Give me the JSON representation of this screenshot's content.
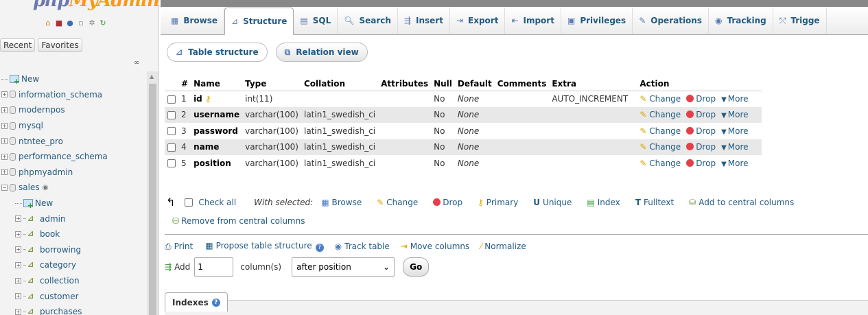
{
  "nav": {
    "logo_a": "php",
    "logo_b": "MyAdmin",
    "tabs": [
      "Recent",
      "Favorites"
    ],
    "tree": [
      {
        "label": "New",
        "type": "new",
        "level": 0
      },
      {
        "label": "information_schema",
        "type": "db",
        "level": 0
      },
      {
        "label": "modernpos",
        "type": "db",
        "level": 0
      },
      {
        "label": "mysql",
        "type": "db",
        "level": 0
      },
      {
        "label": "ntntee_pro",
        "type": "db",
        "level": 0
      },
      {
        "label": "performance_schema",
        "type": "db",
        "level": 0
      },
      {
        "label": "phpmyadmin",
        "type": "db",
        "level": 0
      },
      {
        "label": "sales",
        "type": "db-open",
        "level": 0
      },
      {
        "label": "New",
        "type": "new",
        "level": 1
      },
      {
        "label": "admin",
        "type": "table",
        "level": 1
      },
      {
        "label": "book",
        "type": "table",
        "level": 1
      },
      {
        "label": "borrowing",
        "type": "table",
        "level": 1
      },
      {
        "label": "category",
        "type": "table",
        "level": 1
      },
      {
        "label": "collection",
        "type": "table",
        "level": 1
      },
      {
        "label": "customer",
        "type": "table",
        "level": 1
      },
      {
        "label": "purchases",
        "type": "table",
        "level": 1
      }
    ]
  },
  "tabs": [
    {
      "label": "Browse",
      "icon": "▦",
      "name": "tab-browse"
    },
    {
      "label": "Structure",
      "icon": "⊿",
      "name": "tab-structure",
      "active": true
    },
    {
      "label": "SQL",
      "icon": "▤",
      "name": "tab-sql"
    },
    {
      "label": "Search",
      "icon": "🔍︎",
      "name": "tab-search"
    },
    {
      "label": "Insert",
      "icon": "⇶",
      "name": "tab-insert"
    },
    {
      "label": "Export",
      "icon": "⇥",
      "name": "tab-export"
    },
    {
      "label": "Import",
      "icon": "⇤",
      "name": "tab-import"
    },
    {
      "label": "Privileges",
      "icon": "▣",
      "name": "tab-privileges"
    },
    {
      "label": "Operations",
      "icon": "✎",
      "name": "tab-operations"
    },
    {
      "label": "Tracking",
      "icon": "◉",
      "name": "tab-tracking"
    },
    {
      "label": "Trigge",
      "icon": "⤲",
      "name": "tab-triggers"
    }
  ],
  "subtabs": {
    "structure": "Table structure",
    "relation": "Relation view"
  },
  "table": {
    "headers": [
      "#",
      "Name",
      "Type",
      "Collation",
      "Attributes",
      "Null",
      "Default",
      "Comments",
      "Extra",
      "Action"
    ],
    "rows": [
      {
        "num": "1",
        "name": "id",
        "type": "int(11)",
        "collation": "",
        "attributes": "",
        "null": "No",
        "default": "None",
        "comments": "",
        "extra": "AUTO_INCREMENT",
        "key": true
      },
      {
        "num": "2",
        "name": "username",
        "type": "varchar(100)",
        "collation": "latin1_swedish_ci",
        "attributes": "",
        "null": "No",
        "default": "None",
        "comments": "",
        "extra": ""
      },
      {
        "num": "3",
        "name": "password",
        "type": "varchar(100)",
        "collation": "latin1_swedish_ci",
        "attributes": "",
        "null": "No",
        "default": "None",
        "comments": "",
        "extra": ""
      },
      {
        "num": "4",
        "name": "name",
        "type": "varchar(100)",
        "collation": "latin1_swedish_ci",
        "attributes": "",
        "null": "No",
        "default": "None",
        "comments": "",
        "extra": ""
      },
      {
        "num": "5",
        "name": "position",
        "type": "varchar(100)",
        "collation": "latin1_swedish_ci",
        "attributes": "",
        "null": "No",
        "default": "None",
        "comments": "",
        "extra": ""
      }
    ],
    "actions": {
      "change": "Change",
      "drop": "Drop",
      "more": "More"
    }
  },
  "bulk": {
    "check_all": "Check all",
    "with_selected": "With selected:",
    "browse": "Browse",
    "change": "Change",
    "drop": "Drop",
    "primary": "Primary",
    "unique": "Unique",
    "index": "Index",
    "fulltext": "Fulltext",
    "add_central": "Add to central columns",
    "remove_central": "Remove from central columns"
  },
  "tools": {
    "print": "Print",
    "propose": "Propose table structure",
    "track": "Track table",
    "move": "Move columns",
    "normalize": "Normalize"
  },
  "add_columns": {
    "add_label": "Add",
    "count": "1",
    "unit": "column(s)",
    "position": "after position",
    "go": "Go"
  },
  "indexes": {
    "label": "Indexes"
  }
}
